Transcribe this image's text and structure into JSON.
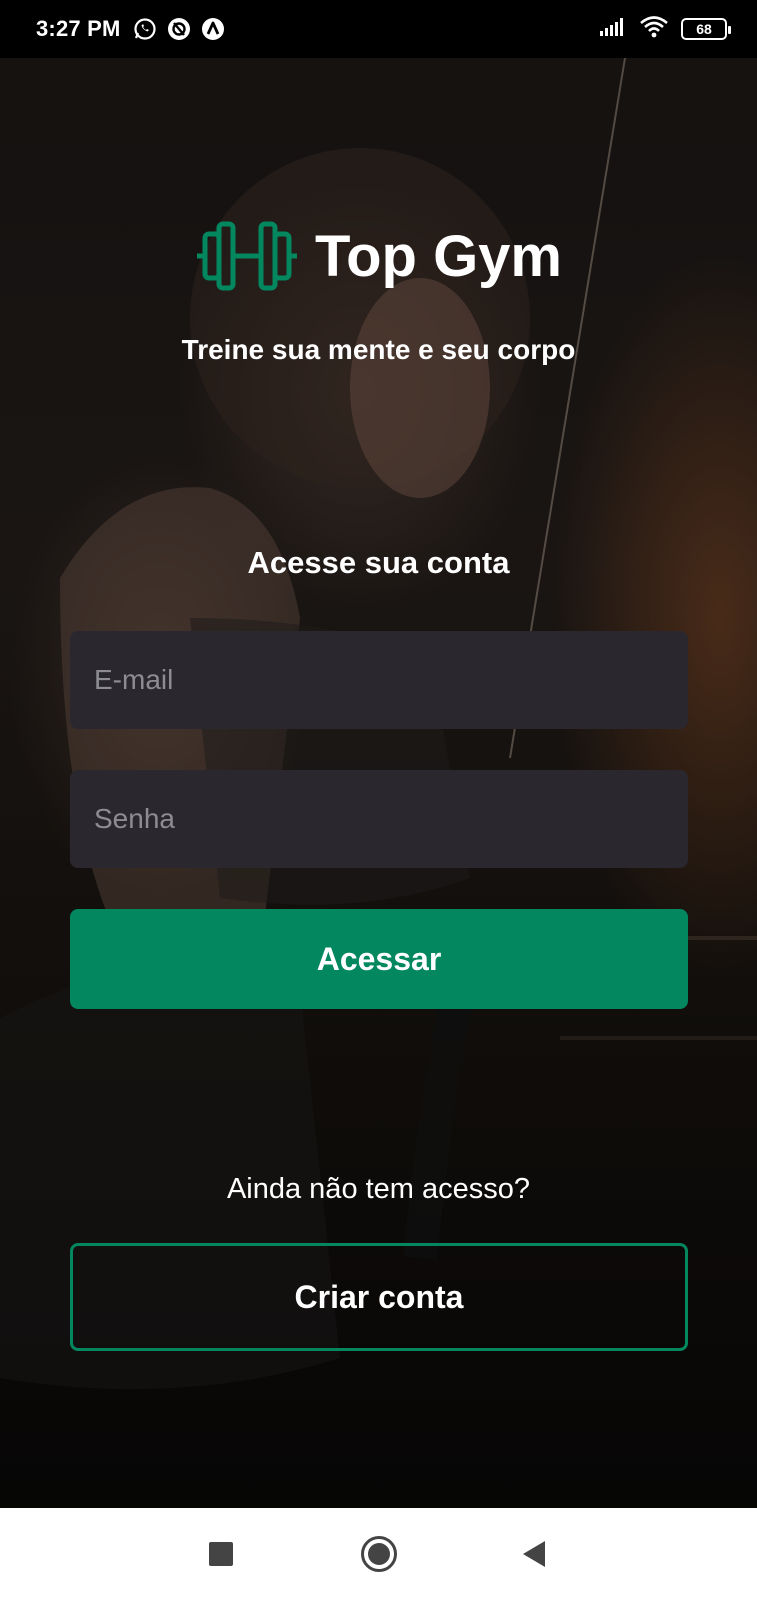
{
  "status_bar": {
    "time": "3:27 PM",
    "left_icons": [
      "whatsapp-icon",
      "sync-icon",
      "app-icon"
    ],
    "battery": "68"
  },
  "app": {
    "brand": "Top Gym",
    "tagline": "Treine sua mente e seu corpo",
    "section_title": "Acesse sua conta",
    "accent_color": "#02875f"
  },
  "form": {
    "email_placeholder": "E-mail",
    "email_value": "",
    "password_placeholder": "Senha",
    "password_value": "",
    "submit_label": "Acessar"
  },
  "signup": {
    "question": "Ainda não tem acesso?",
    "button_label": "Criar conta"
  },
  "nav_bar": {
    "buttons": [
      "recent-apps",
      "home",
      "back"
    ]
  }
}
